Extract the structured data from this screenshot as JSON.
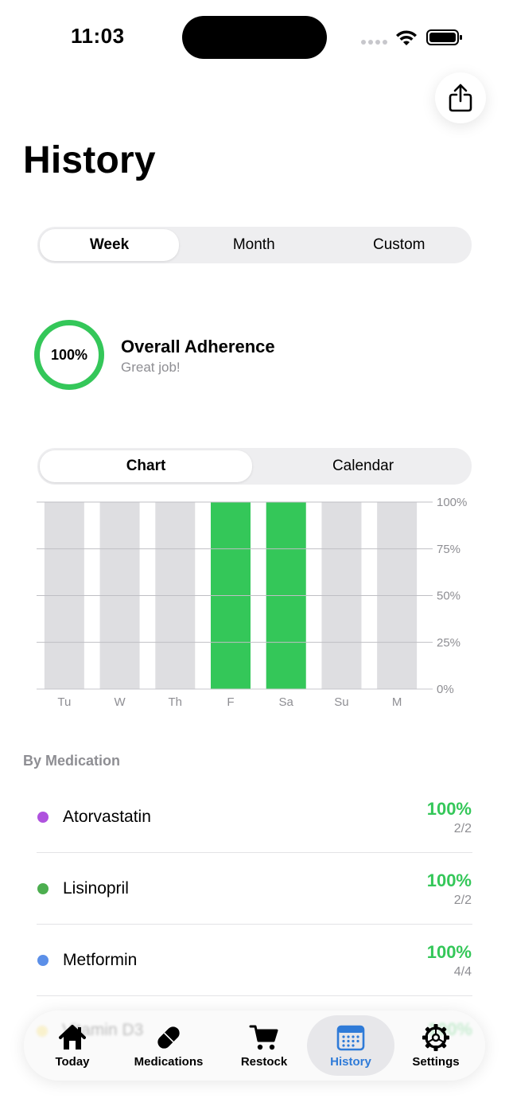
{
  "status_bar": {
    "time": "11:03"
  },
  "header": {
    "title": "History"
  },
  "range_segment": {
    "options": [
      "Week",
      "Month",
      "Custom"
    ],
    "selected": "Week"
  },
  "adherence": {
    "percent_label": "100%",
    "percent": 100,
    "title": "Overall Adherence",
    "subtitle": "Great job!",
    "ring_color": "#34c759"
  },
  "view_segment": {
    "options": [
      "Chart",
      "Calendar"
    ],
    "selected": "Chart"
  },
  "chart_data": {
    "type": "bar",
    "categories": [
      "Tu",
      "W",
      "Th",
      "F",
      "Sa",
      "Su",
      "M"
    ],
    "values": [
      0,
      0,
      0,
      100,
      100,
      0,
      0
    ],
    "ylim": [
      0,
      100
    ],
    "yticks": [
      "100%",
      "75%",
      "50%",
      "25%",
      "0%"
    ],
    "ytick_values": [
      100,
      75,
      50,
      25,
      0
    ],
    "grid": true,
    "bar_color": "#34c759",
    "empty_color": "#dedee1"
  },
  "by_medication": {
    "title": "By Medication",
    "items": [
      {
        "name": "Atorvastatin",
        "percent": "100%",
        "count": "2/2",
        "color": "#af52de"
      },
      {
        "name": "Lisinopril",
        "percent": "100%",
        "count": "2/2",
        "color": "#4cae4f"
      },
      {
        "name": "Metformin",
        "percent": "100%",
        "count": "4/4",
        "color": "#5b8fe8"
      }
    ],
    "partial_item": {
      "name": "Vitamin D3",
      "percent": "100%",
      "color": "#f7d84a"
    }
  },
  "tabbar": {
    "items": [
      {
        "label": "Today",
        "icon": "house-icon"
      },
      {
        "label": "Medications",
        "icon": "pill-icon"
      },
      {
        "label": "Restock",
        "icon": "cart-icon"
      },
      {
        "label": "History",
        "icon": "calendar-icon"
      },
      {
        "label": "Settings",
        "icon": "gear-icon"
      }
    ],
    "selected": "History",
    "accent": "#2f7bd8"
  }
}
